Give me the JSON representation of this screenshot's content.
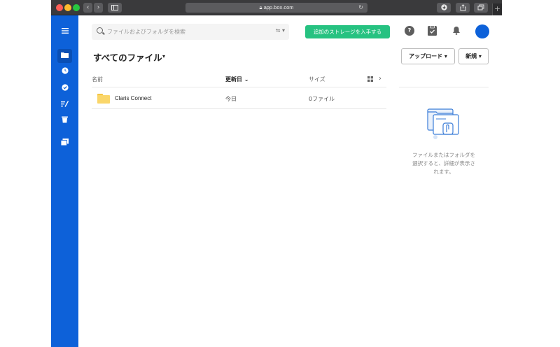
{
  "browser": {
    "url": "app.box.com",
    "back_glyph": "‹",
    "forward_glyph": "›"
  },
  "header": {
    "search_placeholder": "ファイルおよびフォルダを検索",
    "storage_button_label": "追加のストレージを入手する",
    "help_glyph": "?"
  },
  "main": {
    "title": "すべてのファイル",
    "upload_label": "アップロード ▾",
    "new_label": "新規 ▾"
  },
  "table": {
    "columns": {
      "name": "名前",
      "updated": "更新日 ⌄",
      "size": "サイズ"
    },
    "rows": [
      {
        "name": "Claris Connect",
        "updated": "今日",
        "size": "0ファイル"
      }
    ]
  },
  "details_panel": {
    "empty_text": "ファイルまたはフォルダを選択すると、詳細が表示されます。"
  },
  "colors": {
    "brand_blue": "#0d61d9",
    "storage_green": "#26c281",
    "folder_yellow": "#fad66a"
  }
}
